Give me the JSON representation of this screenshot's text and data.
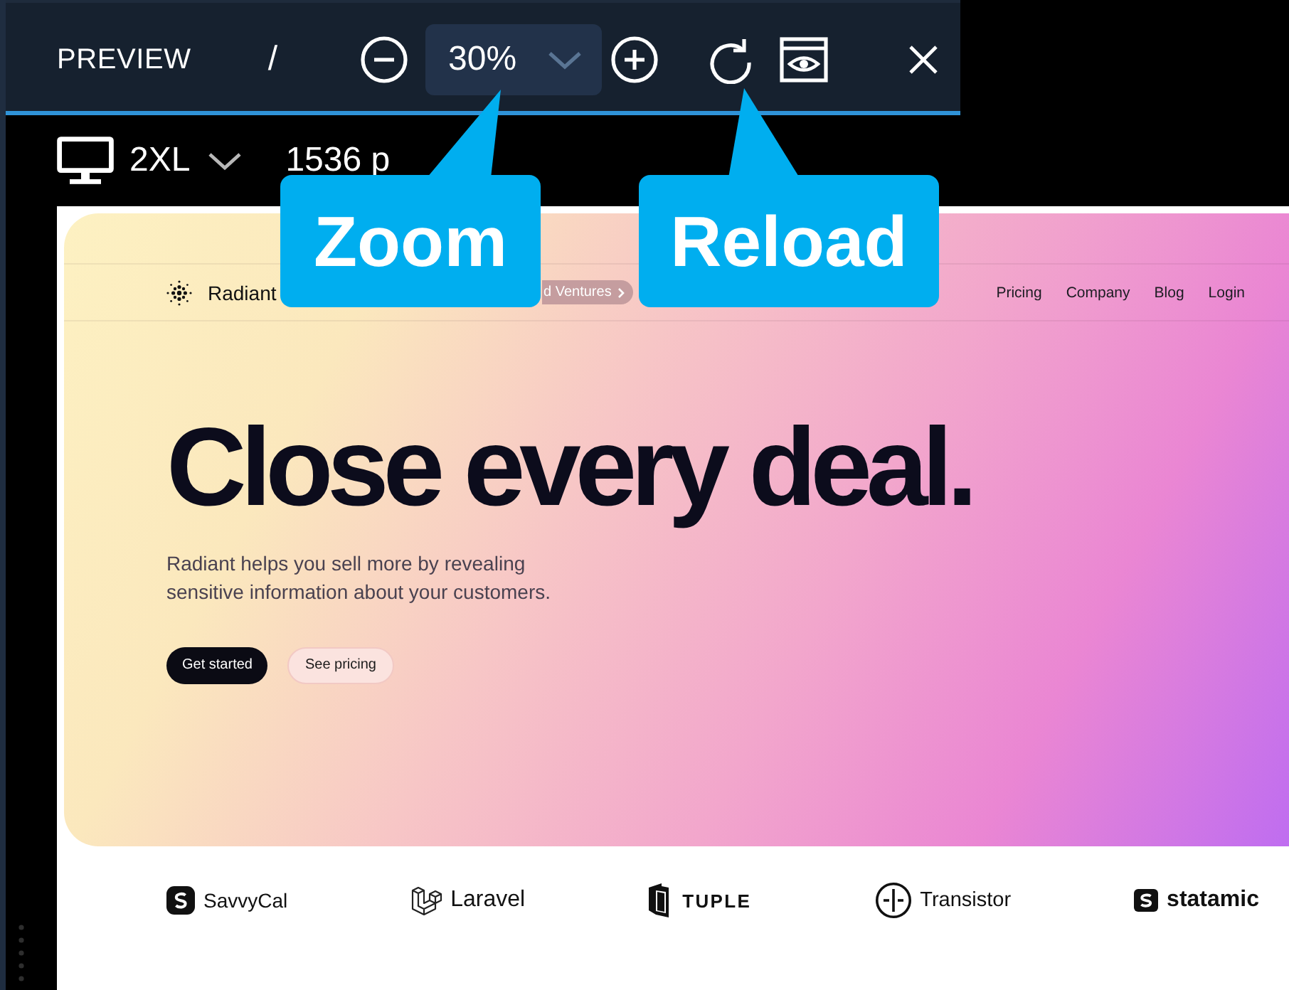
{
  "toolbar": {
    "title": "PREVIEW",
    "separator": "/",
    "zoom_level": "30%"
  },
  "device_bar": {
    "device": "2XL",
    "viewport_width": "1536 p"
  },
  "preview": {
    "nav": {
      "brand": "Radiant",
      "announcement": "d Ventures",
      "links": [
        "Pricing",
        "Company",
        "Blog",
        "Login"
      ]
    },
    "hero": {
      "headline": "Close every deal.",
      "lead": "Radiant helps you sell more by revealing sensitive information about your customers.",
      "buttons": [
        {
          "label": "Get started",
          "kind": "primary"
        },
        {
          "label": "See pricing",
          "kind": "secondary"
        }
      ]
    },
    "logos": [
      {
        "name": "SavvyCal",
        "kind": "savvycal"
      },
      {
        "name": "Laravel",
        "kind": "laravel"
      },
      {
        "name": "TUPLE",
        "kind": "tuple"
      },
      {
        "name": "Transistor",
        "kind": "transistor"
      },
      {
        "name": "statamic",
        "kind": "statamic"
      }
    ]
  },
  "callouts": [
    {
      "label": "Zoom",
      "kind": "zoom"
    },
    {
      "label": "Reload",
      "kind": "reload"
    }
  ]
}
